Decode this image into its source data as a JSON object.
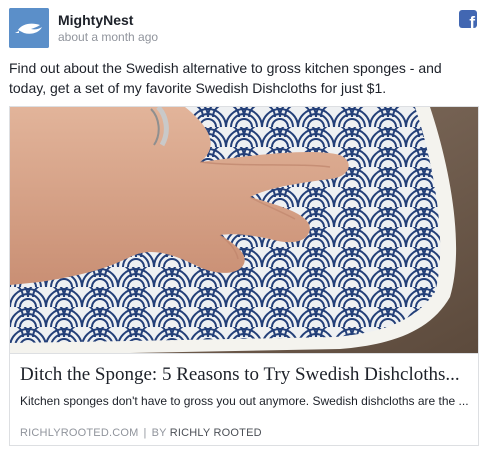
{
  "post": {
    "page_name": "MightyNest",
    "timestamp": "about a month ago",
    "message": "Find out about the Swedish alternative to gross kitchen sponges - and today, get a set of my favorite Swedish Dishcloths for just $1.",
    "icons": {
      "avatar": "mightynest-bird-logo",
      "platform": "facebook-icon"
    },
    "link": {
      "image_subject": "hand resting on swedish dishcloth",
      "title": "Ditch the Sponge: 5 Reasons to Try Swedish Dishcloths...",
      "description": "Kitchen sponges don't have to gross you out anymore. Swedish dishcloths are the ...",
      "source_domain": "RICHLYROOTED.COM",
      "separator": "|",
      "byline_prefix": "BY",
      "author": "RICHLY ROOTED"
    }
  },
  "colors": {
    "facebook_blue": "#4267b2",
    "avatar_blue": "#5b8fc9",
    "meta_gray": "#90949c",
    "text_dark": "#1d2129",
    "border": "#dddfe2",
    "cloth_navy": "#233f78"
  }
}
